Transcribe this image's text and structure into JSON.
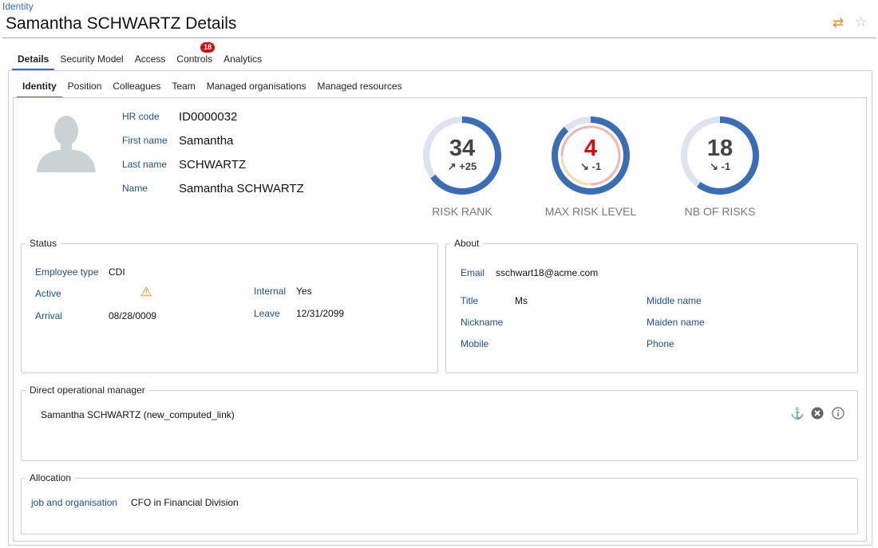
{
  "breadcrumb": "Identity",
  "title": "Samantha SCHWARTZ Details",
  "icons": {
    "sync": "sync-icon",
    "star": "star-icon"
  },
  "tabs": [
    {
      "label": "Details",
      "active": true
    },
    {
      "label": "Security Model"
    },
    {
      "label": "Access"
    },
    {
      "label": "Controls",
      "badge": "18"
    },
    {
      "label": "Analytics"
    }
  ],
  "subtabs": [
    {
      "label": "Identity",
      "active": true
    },
    {
      "label": "Position"
    },
    {
      "label": "Colleagues"
    },
    {
      "label": "Team"
    },
    {
      "label": "Managed organisations"
    },
    {
      "label": "Managed resources"
    }
  ],
  "identity": {
    "hr_code_label": "HR code",
    "hr_code": "ID0000032",
    "first_name_label": "First name",
    "first_name": "Samantha",
    "last_name_label": "Last name",
    "last_name": "SCHWARTZ",
    "name_label": "Name",
    "name": "Samantha SCHWARTZ"
  },
  "gauges": [
    {
      "value": "34",
      "delta": "+25",
      "delta_dir": "up",
      "caption": "RISK RANK",
      "fraction": 0.65,
      "value_color": "#444444"
    },
    {
      "value": "4",
      "delta": "-1",
      "delta_dir": "down",
      "caption": "MAX RISK LEVEL",
      "fraction": 0.88,
      "value_color": "#d01010"
    },
    {
      "value": "18",
      "delta": "-1",
      "delta_dir": "down",
      "caption": "NB OF RISKS",
      "fraction": 0.6,
      "value_color": "#444444"
    }
  ],
  "status": {
    "legend": "Status",
    "employee_type_label": "Employee type",
    "employee_type": "CDI",
    "active_label": "Active",
    "active_icon": "warning-icon",
    "arrival_label": "Arrival",
    "arrival": "08/28/0009",
    "internal_label": "Internal",
    "internal": "Yes",
    "leave_label": "Leave",
    "leave": "12/31/2099"
  },
  "about": {
    "legend": "About",
    "email_label": "Email",
    "email": "sschwart18@acme.com",
    "title_label": "Title",
    "title": "Ms",
    "middle_name_label": "Middle name",
    "nickname_label": "Nickname",
    "maiden_name_label": "Maiden name",
    "mobile_label": "Mobile",
    "phone_label": "Phone"
  },
  "manager": {
    "legend": "Direct operational manager",
    "value": "Samantha SCHWARTZ (new_computed_link)"
  },
  "allocation": {
    "legend": "Allocation",
    "label": "job and organisation",
    "value": "CFO in Financial Division"
  },
  "colors": {
    "accent": "#3b6db5",
    "label": "#1f4e8c",
    "gauge_track": "#dde3ef",
    "danger": "#d01010",
    "warning": "#e0802a"
  }
}
